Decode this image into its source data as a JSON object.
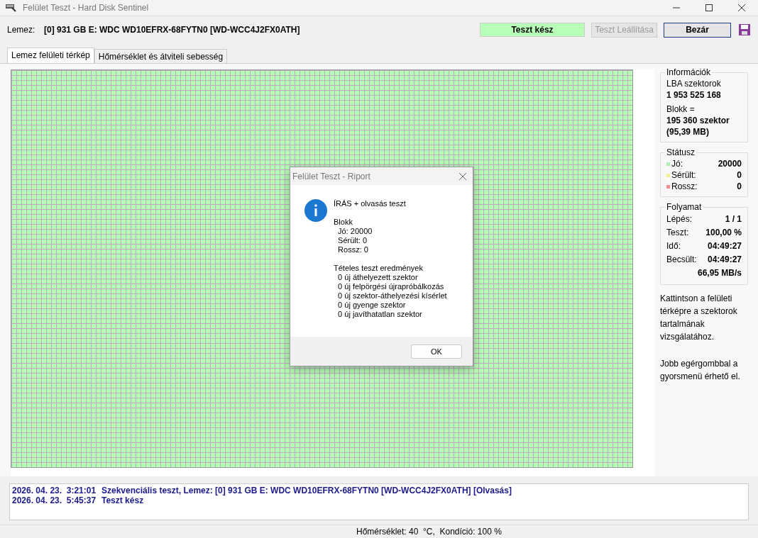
{
  "window": {
    "title": "Felület Teszt - Hard Disk Sentinel"
  },
  "toolbar": {
    "disk_label": "Lemez:",
    "disk": "[0] 931 GB E: WDC WD10EFRX-68FYTN0 [WD-WCC4J2FX0ATH]",
    "status": "Teszt kész",
    "buttons": [
      {
        "label": "Teszt Leállítása",
        "disabled": true
      },
      {
        "label": "Bezár",
        "disabled": false
      }
    ]
  },
  "tabs": [
    {
      "label": "Lemez felületi térkép",
      "selected": true
    },
    {
      "label": "Hőmérséklet és átviteli sebesség",
      "selected": false
    }
  ],
  "info": {
    "title": "Információk",
    "lba_label": "LBA szektorok",
    "lba": "1 953 525 168",
    "block_label": "Blokk =",
    "block": "195 360 szektor",
    "block_mb": "(95,39 MB)"
  },
  "status": {
    "title": "Státusz",
    "items": [
      {
        "label": "Jó:",
        "value": "20000",
        "color": "#b0f0b0"
      },
      {
        "label": "Sérült:",
        "value": "0",
        "color": "#f0f090"
      },
      {
        "label": "Rossz:",
        "value": "0",
        "color": "#f09090"
      }
    ]
  },
  "progress": {
    "title": "Folyamat",
    "rows": [
      {
        "label": "Lépés:",
        "value": "1 / 1"
      },
      {
        "label": "Teszt:",
        "value": "100,00 %"
      },
      {
        "label": "Idő:",
        "value": "04:49:27"
      },
      {
        "label": "Becsült:",
        "value": "04:49:27"
      },
      {
        "label": "",
        "value": "66,95 MB/s"
      }
    ]
  },
  "hints": [
    "Kattintson a felületi térképre a szektorok tartalmának vizsgálatához.",
    "Jobb egérgombbal a gyorsmenü érhető el."
  ],
  "dialog": {
    "title": "Felület Teszt - Riport",
    "paragraphs": [
      [
        "ÍRÁS + olvasás teszt"
      ],
      [
        "Blokk",
        "  Jó: 20000",
        "  Sérült: 0",
        "  Rossz: 0"
      ],
      [
        "Tételes teszt eredmények",
        "  0 új áthelyezett szektor",
        "  0 új felpörgési újrapróbálkozás",
        "  0 új szektor-áthelyezési kísérlet",
        "  0 új gyenge szektor",
        "  0 új javíthatatlan szektor"
      ]
    ],
    "button": "OK"
  },
  "log": [
    {
      "time": "2026. 04. 23.  3:21:01",
      "message": "Szekvenciális teszt, Lemez: [0] 931 GB E: WDC WD10EFRX-68FYTN0 [WD-WCC4J2FX0ATH] [Olvasás]"
    },
    {
      "time": "2026. 04. 23.  5:45:37",
      "message": "Teszt kész"
    }
  ],
  "status_bar": "Hőmérséklet: 40  °C,  Kondíció: 100 %"
}
